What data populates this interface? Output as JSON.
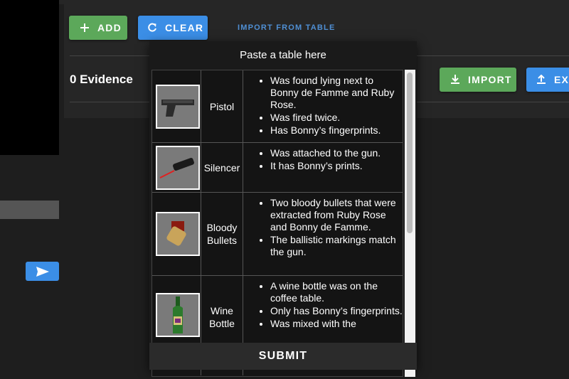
{
  "toolbar": {
    "add_label": "ADD",
    "clear_label": "CLEAR",
    "import_from_table_label": "IMPORT FROM TABLE",
    "import_label": "IMPORT",
    "export_label": "EXP"
  },
  "evidence": {
    "count_label": "0 Evidence"
  },
  "dialog": {
    "title": "Paste a table here",
    "submit_label": "SUBMIT",
    "rows": [
      {
        "name": "Pistol",
        "icon": "pistol-image",
        "bullets": [
          "Was found lying next to Bonny de Famme and Ruby Rose.",
          "Was fired twice.",
          "Has Bonny’s fingerprints."
        ]
      },
      {
        "name": "Silencer",
        "icon": "silencer-image",
        "bullets": [
          "Was attached to the gun.",
          "It has Bonny’s prints."
        ]
      },
      {
        "name": "Bloody Bullets",
        "icon": "bullets-image",
        "bullets": [
          "Two bloody bullets that were extracted from Ruby Rose and Bonny de Famme.",
          "The ballistic markings match the gun."
        ]
      },
      {
        "name": "Wine Bottle",
        "icon": "wine-bottle-image",
        "bullets": [
          "A wine bottle was on the coffee table.",
          "Only has Bonny’s fingerprints.",
          "Was mixed with the"
        ]
      }
    ]
  },
  "colors": {
    "green": "#5ca85a",
    "blue": "#3b8ee6",
    "link": "#4f8fd4"
  }
}
